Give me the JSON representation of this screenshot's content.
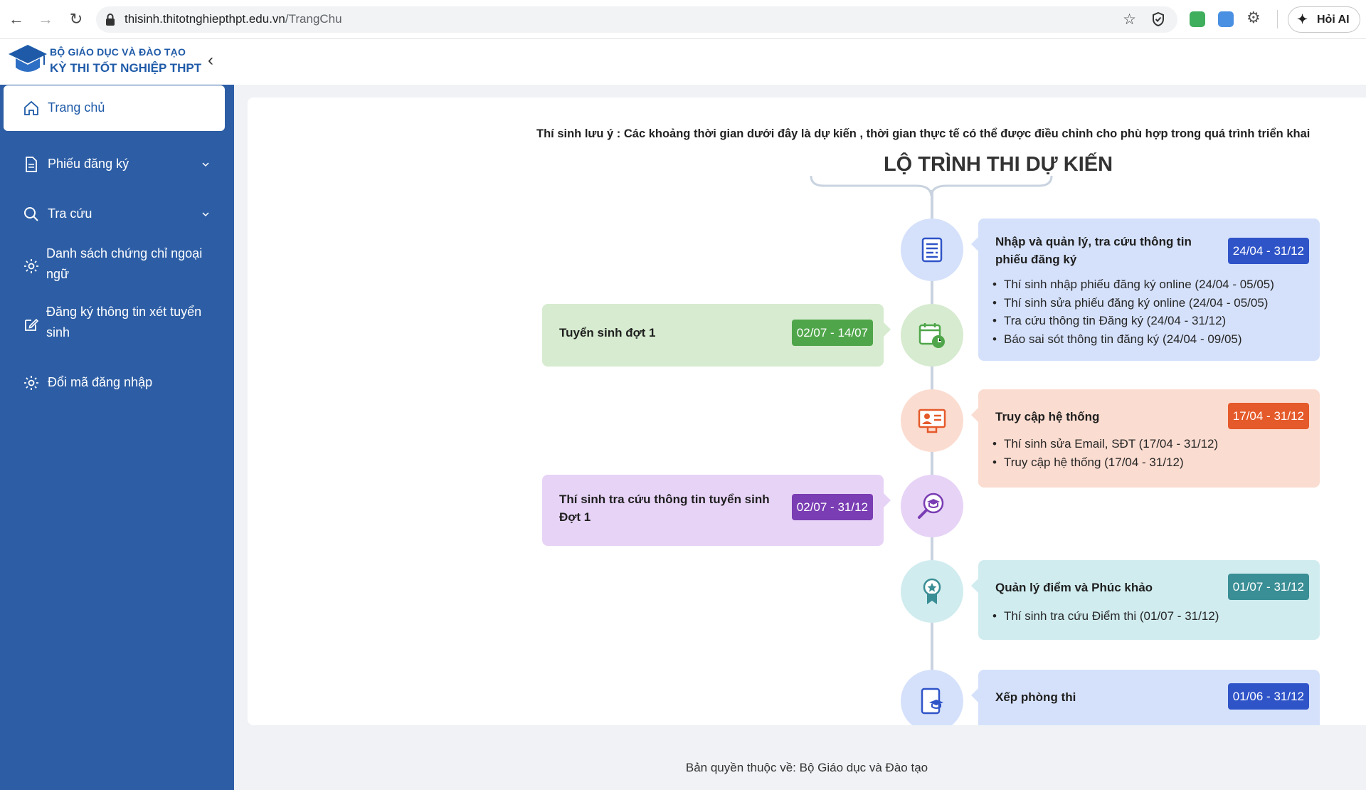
{
  "browser": {
    "url_domain": "thisinh.thitotnghiepthpt.edu.vn",
    "url_path": "/TrangChu",
    "ai_button_label": "Hỏi AI",
    "icons": [
      "back-arrow-icon",
      "forward-arrow-icon",
      "reload-icon",
      "lock-icon",
      "star-icon",
      "shield-icon",
      "extension-icon",
      "puzzle-icon",
      "sparkle-icon"
    ]
  },
  "header": {
    "org_name": "BỘ GIÁO DỤC VÀ ĐÀO TẠO",
    "app_name": "KỲ THI TỐT NGHIỆP THPT"
  },
  "sidebar": {
    "items": [
      {
        "label": "Trang chủ",
        "icon": "home-icon",
        "active": true
      },
      {
        "label": "Phiếu đăng ký",
        "icon": "document-icon",
        "has_submenu": true
      },
      {
        "label": "Tra cứu",
        "icon": "search-icon",
        "has_submenu": true
      },
      {
        "label": "Danh sách chứng chỉ ngoại ngữ",
        "icon": "gear-icon"
      },
      {
        "label": "Đăng ký thông tin xét tuyển sinh",
        "icon": "edit-icon"
      },
      {
        "label": "Đổi mã đăng nhập",
        "icon": "gear-icon"
      }
    ]
  },
  "main": {
    "note": "Thí sinh lưu ý : Các khoảng thời gian dưới đây là dự kiến , thời gian thực tế có thể được điều chỉnh cho phù hợp trong quá trình triển khai",
    "title": "LỘ TRÌNH THI DỰ KIẾN",
    "timeline": [
      {
        "side": "right",
        "title": "Nhập và quản lý, tra cứu thông tin phiếu đăng ký",
        "date_range": "24/04 - 31/12",
        "badge_color": "#2f54c8",
        "bg_color": "#d5e1fb",
        "icon": "document-list-icon",
        "bullets": [
          "Thí sinh nhập phiếu đăng ký online (24/04 - 05/05)",
          "Thí sinh sửa phiếu đăng ký online (24/04 - 05/05)",
          "Tra cứu thông tin Đăng ký (24/04 - 31/12)",
          "Báo sai sót thông tin đăng ký (24/04 - 09/05)"
        ]
      },
      {
        "side": "left",
        "title": "Tuyển sinh đợt 1",
        "date_range": "02/07 - 14/07",
        "badge_color": "#4fa64a",
        "bg_color": "#d6ebcf",
        "icon": "calendar-clock-icon",
        "bullets": []
      },
      {
        "side": "right",
        "title": "Truy cập hệ thống",
        "date_range": "17/04 - 31/12",
        "badge_color": "#e55a2a",
        "bg_color": "#fbdcd0",
        "icon": "user-monitor-icon",
        "bullets": [
          "Thí sinh sửa Email, SĐT (17/04 - 31/12)",
          "Truy cập hệ thống (17/04 - 31/12)"
        ]
      },
      {
        "side": "left",
        "title": "Thí sinh tra cứu thông tin tuyển sinh Đợt 1",
        "date_range": "02/07 - 31/12",
        "badge_color": "#7a3db3",
        "bg_color": "#e7d3f6",
        "icon": "graduation-search-icon",
        "bullets": []
      },
      {
        "side": "right",
        "title": "Quản lý điểm và Phúc khảo",
        "date_range": "01/07 - 31/12",
        "badge_color": "#3a8e95",
        "bg_color": "#d0ecef",
        "icon": "award-ribbon-icon",
        "bullets": [
          "Thí sinh tra cứu Điểm thi (01/07 - 31/12)"
        ]
      },
      {
        "side": "right",
        "title": "Xếp phòng thi",
        "date_range": "01/06 - 31/12",
        "badge_color": "#2f54c8",
        "bg_color": "#d5e1fb",
        "icon": "exam-room-icon",
        "bullets": []
      }
    ]
  },
  "footer": {
    "copyright": "Bản quyền thuộc về: Bộ Giáo dục và Đào tạo"
  }
}
